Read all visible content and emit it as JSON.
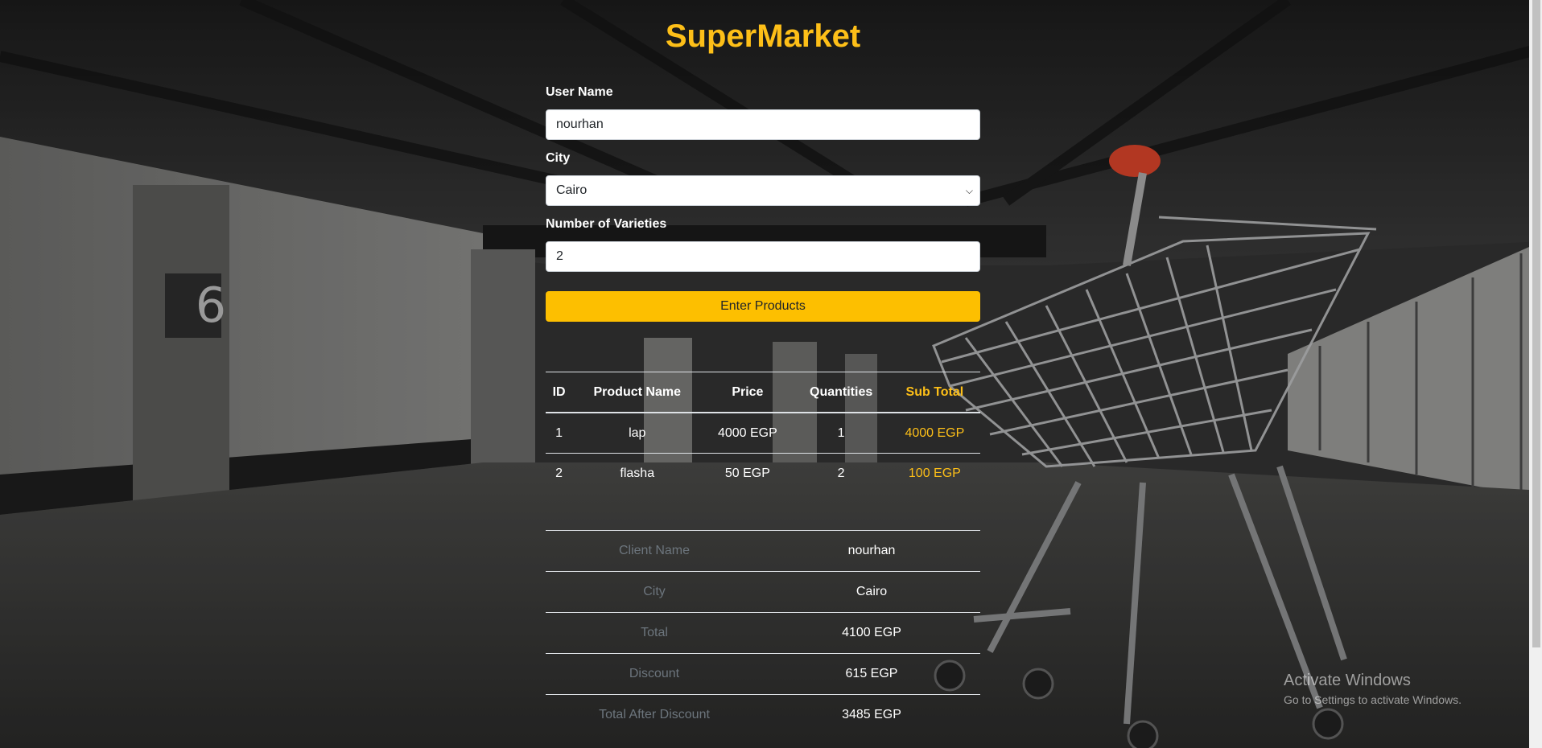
{
  "header": {
    "title": "SuperMarket"
  },
  "form": {
    "user_name_label": "User Name",
    "user_name_value": "nourhan",
    "city_label": "City",
    "city_value": "Cairo",
    "varieties_label": "Number of Varieties",
    "varieties_value": "2",
    "submit_label": "Enter Products"
  },
  "products": {
    "headers": [
      "ID",
      "Product Name",
      "Price",
      "Quantities",
      "Sub Total"
    ],
    "rows": [
      [
        "1",
        "lap",
        "4000 EGP",
        "1",
        "4000 EGP"
      ],
      [
        "2",
        "flasha",
        "50 EGP",
        "2",
        "100 EGP"
      ]
    ]
  },
  "summary": [
    {
      "label": "Client Name",
      "value": "nourhan"
    },
    {
      "label": "City",
      "value": "Cairo"
    },
    {
      "label": "Total",
      "value": "4100 EGP"
    },
    {
      "label": "Discount",
      "value": "615 EGP"
    },
    {
      "label": "Total After Discount",
      "value": "3485 EGP"
    }
  ],
  "watermark": {
    "line1": "Activate Windows",
    "line2": "Go to Settings to activate Windows."
  },
  "colors": {
    "accent": "#fdbf18",
    "button": "#fdbf00"
  }
}
